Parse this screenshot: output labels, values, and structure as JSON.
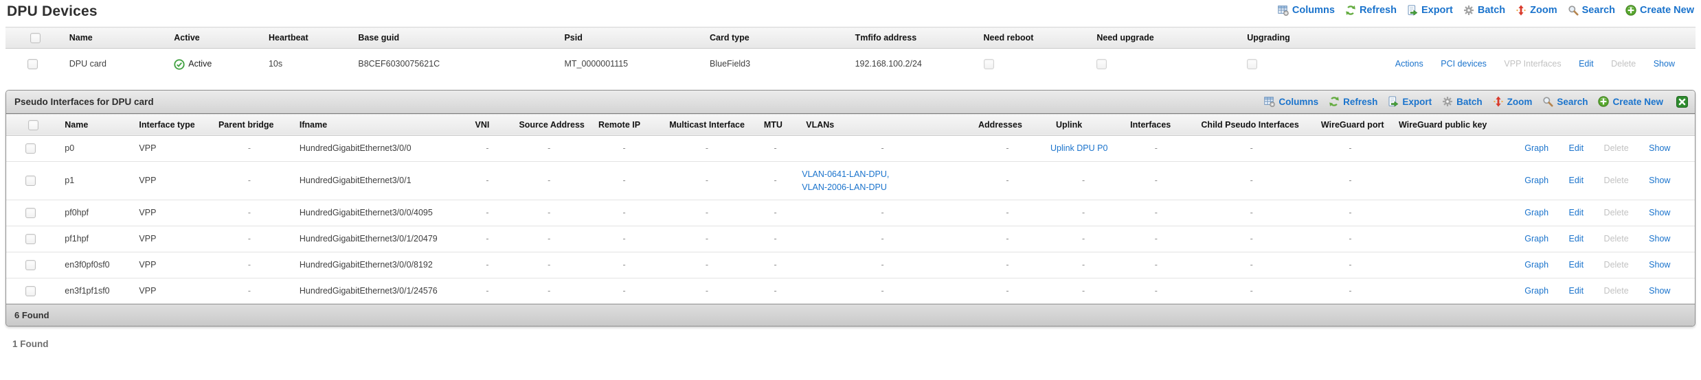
{
  "page": {
    "title": "DPU Devices",
    "bottom_count": "1 Found"
  },
  "colors": {
    "link_blue": "#1a73cc",
    "disabled_gray": "#c2c2c2",
    "success_green": "#44a344",
    "refresh_green": "#63ab3f",
    "zoom_red": "#d93a2c",
    "close_green": "#2e8b2e"
  },
  "icons": {
    "columns": "table-grid-icon",
    "refresh": "refresh-icon",
    "export": "export-icon",
    "batch": "gear-icon",
    "zoom": "resize-vertical-icon",
    "search": "magnifier-icon",
    "create_new": "plus-circle-icon",
    "close": "close-icon",
    "active": "check-circle-icon"
  },
  "toolbar": {
    "columns": "Columns",
    "refresh": "Refresh",
    "export": "Export",
    "batch": "Batch",
    "zoom": "Zoom",
    "search": "Search",
    "create_new": "Create New"
  },
  "devices_table": {
    "headers": [
      "Name",
      "Active",
      "Heartbeat",
      "Base guid",
      "Psid",
      "Card type",
      "Tmfifo address",
      "Need reboot",
      "Need upgrade",
      "Upgrading"
    ],
    "row": {
      "name": "DPU card",
      "active_label": "Active",
      "heartbeat": "10s",
      "base_guid": "B8CEF6030075621C",
      "psid": "MT_0000001115",
      "card_type": "BlueField3",
      "tmfifo_address": "192.168.100.2/24",
      "actions": {
        "actions": "Actions",
        "pci_devices": "PCI devices",
        "vpp_interfaces": "VPP Interfaces",
        "edit": "Edit",
        "delete": "Delete",
        "show": "Show"
      }
    }
  },
  "panel": {
    "title": "Pseudo Interfaces for DPU card",
    "footer_count": "6 Found",
    "table": {
      "headers": [
        "Name",
        "Interface type",
        "Parent bridge",
        "Ifname",
        "VNI",
        "Source Address",
        "Remote IP",
        "Multicast Interface",
        "MTU",
        "VLANs",
        "Addresses",
        "Uplink",
        "Interfaces",
        "Child Pseudo Interfaces",
        "WireGuard port",
        "WireGuard public key"
      ],
      "rows": [
        {
          "name": "p0",
          "interface_type": "VPP",
          "parent_bridge": "-",
          "ifname": "HundredGigabitEthernet3/0/0",
          "vni": "-",
          "source_address": "-",
          "remote_ip": "-",
          "multicast_interface": "-",
          "mtu": "-",
          "vlans_text": "-",
          "vlan_link1": "",
          "vlan_link2": "",
          "addresses": "-",
          "uplink_text": "",
          "uplink_link": "Uplink DPU P0",
          "interfaces": "-",
          "child_pseudo_interfaces": "-",
          "wireguard_port": "-",
          "wireguard_public_key": "",
          "actions": {
            "graph": "Graph",
            "edit": "Edit",
            "delete": "Delete",
            "show": "Show"
          }
        },
        {
          "name": "p1",
          "interface_type": "VPP",
          "parent_bridge": "-",
          "ifname": "HundredGigabitEthernet3/0/1",
          "vni": "-",
          "source_address": "-",
          "remote_ip": "-",
          "multicast_interface": "-",
          "mtu": "-",
          "vlans_text": "",
          "vlan_link1": "VLAN-0641-LAN-DPU,",
          "vlan_link2": "VLAN-2006-LAN-DPU",
          "addresses": "-",
          "uplink_text": "-",
          "uplink_link": "",
          "interfaces": "-",
          "child_pseudo_interfaces": "-",
          "wireguard_port": "-",
          "wireguard_public_key": "",
          "actions": {
            "graph": "Graph",
            "edit": "Edit",
            "delete": "Delete",
            "show": "Show"
          }
        },
        {
          "name": "pf0hpf",
          "interface_type": "VPP",
          "parent_bridge": "-",
          "ifname": "HundredGigabitEthernet3/0/0/4095",
          "vni": "-",
          "source_address": "-",
          "remote_ip": "-",
          "multicast_interface": "-",
          "mtu": "-",
          "vlans_text": "-",
          "vlan_link1": "",
          "vlan_link2": "",
          "addresses": "-",
          "uplink_text": "-",
          "uplink_link": "",
          "interfaces": "-",
          "child_pseudo_interfaces": "-",
          "wireguard_port": "-",
          "wireguard_public_key": "",
          "actions": {
            "graph": "Graph",
            "edit": "Edit",
            "delete": "Delete",
            "show": "Show"
          }
        },
        {
          "name": "pf1hpf",
          "interface_type": "VPP",
          "parent_bridge": "-",
          "ifname": "HundredGigabitEthernet3/0/1/20479",
          "vni": "-",
          "source_address": "-",
          "remote_ip": "-",
          "multicast_interface": "-",
          "mtu": "-",
          "vlans_text": "-",
          "vlan_link1": "",
          "vlan_link2": "",
          "addresses": "-",
          "uplink_text": "-",
          "uplink_link": "",
          "interfaces": "-",
          "child_pseudo_interfaces": "-",
          "wireguard_port": "-",
          "wireguard_public_key": "",
          "actions": {
            "graph": "Graph",
            "edit": "Edit",
            "delete": "Delete",
            "show": "Show"
          }
        },
        {
          "name": "en3f0pf0sf0",
          "interface_type": "VPP",
          "parent_bridge": "-",
          "ifname": "HundredGigabitEthernet3/0/0/8192",
          "vni": "-",
          "source_address": "-",
          "remote_ip": "-",
          "multicast_interface": "-",
          "mtu": "-",
          "vlans_text": "-",
          "vlan_link1": "",
          "vlan_link2": "",
          "addresses": "-",
          "uplink_text": "-",
          "uplink_link": "",
          "interfaces": "-",
          "child_pseudo_interfaces": "-",
          "wireguard_port": "-",
          "wireguard_public_key": "",
          "actions": {
            "graph": "Graph",
            "edit": "Edit",
            "delete": "Delete",
            "show": "Show"
          }
        },
        {
          "name": "en3f1pf1sf0",
          "interface_type": "VPP",
          "parent_bridge": "-",
          "ifname": "HundredGigabitEthernet3/0/1/24576",
          "vni": "-",
          "source_address": "-",
          "remote_ip": "-",
          "multicast_interface": "-",
          "mtu": "-",
          "vlans_text": "-",
          "vlan_link1": "",
          "vlan_link2": "",
          "addresses": "-",
          "uplink_text": "-",
          "uplink_link": "",
          "interfaces": "-",
          "child_pseudo_interfaces": "-",
          "wireguard_port": "-",
          "wireguard_public_key": "",
          "actions": {
            "graph": "Graph",
            "edit": "Edit",
            "delete": "Delete",
            "show": "Show"
          }
        }
      ]
    }
  }
}
